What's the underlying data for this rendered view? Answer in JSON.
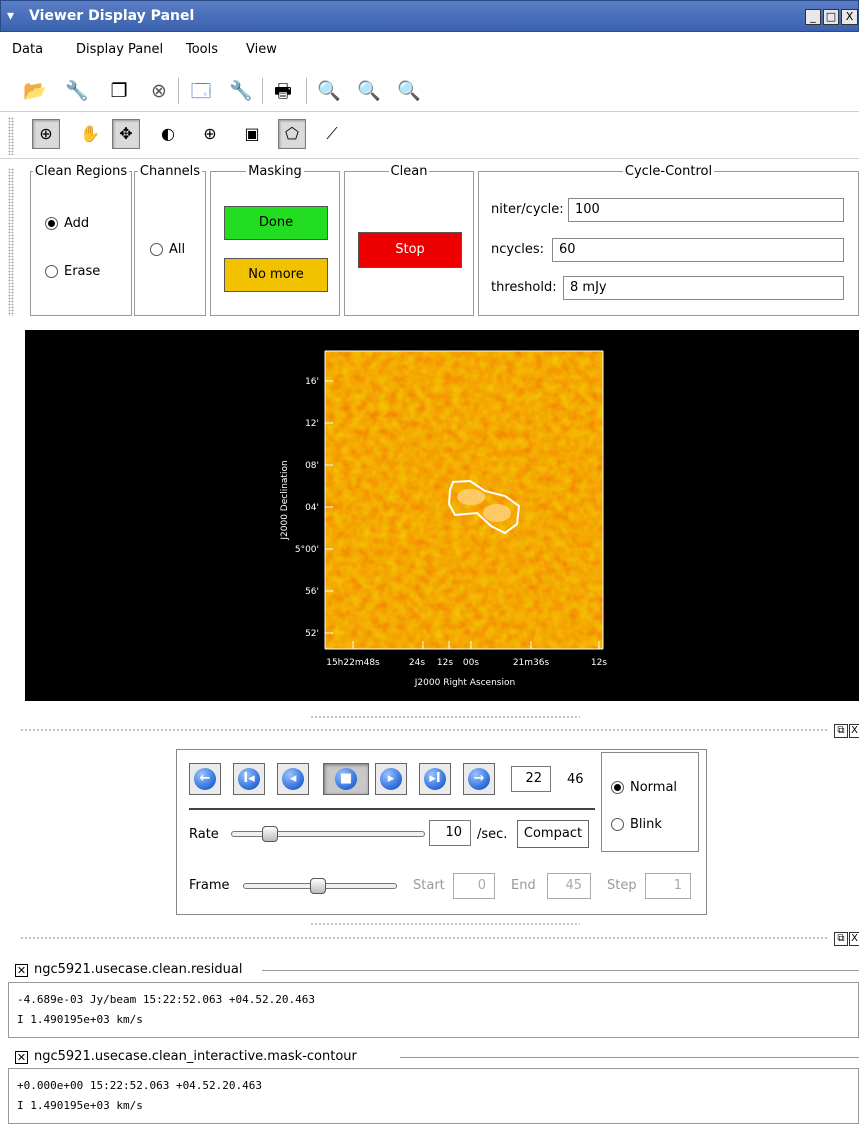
{
  "window": {
    "title": "Viewer Display Panel",
    "minimize": "_",
    "maximize": "□",
    "close": "X"
  },
  "menu": [
    "Data",
    "Display Panel",
    "Tools",
    "View"
  ],
  "toolbar1_icons": [
    "open-icon",
    "wrench-icon",
    "copy-window-icon",
    "close-circle-icon",
    "new-panel-icon",
    "options-icon",
    "print-icon",
    "zoom-fit-icon",
    "zoom-in-icon",
    "zoom-out-icon"
  ],
  "toolbar2_icons": [
    "zoom-tool-icon",
    "pan-tool-icon",
    "move-tool-icon",
    "contrast-tool-icon",
    "crosshair-tool-icon",
    "rectangle-region-icon",
    "polygon-region-icon",
    "polyline-tool-icon"
  ],
  "panels": {
    "clean_regions": {
      "legend": "Clean Regions",
      "add": "Add",
      "erase": "Erase",
      "selected": "Add"
    },
    "channels": {
      "legend": "Channels",
      "all": "All"
    },
    "masking": {
      "legend": "Masking",
      "done": "Done",
      "no_more": "No more"
    },
    "clean": {
      "legend": "Clean",
      "stop": "Stop"
    },
    "cycle_control": {
      "legend": "Cycle-Control",
      "niter_label": "niter/cycle:",
      "niter_value": "100",
      "ncycles_label": "ncycles:",
      "ncycles_value": "60",
      "threshold_label": "threshold:",
      "threshold_value": "8 mJy"
    }
  },
  "colors": {
    "done": "#22dd22",
    "no_more": "#f2c200",
    "stop": "#ee0000",
    "contour": "#ffffff"
  },
  "plot": {
    "yticks": [
      "16'",
      "12'",
      "08'",
      "04'",
      "5°00'",
      "56'",
      "52'"
    ],
    "xticks": [
      "15h22m48s",
      "24s",
      "12s",
      "00s",
      "21m36s",
      "12s"
    ],
    "ylabel": "J2000 Declination",
    "xlabel": "J2000 Right Ascension"
  },
  "animator": {
    "current_frame": "22",
    "total_frames": "46",
    "mode_normal": "Normal",
    "mode_blink": "Blink",
    "mode_selected": "Normal",
    "rate_label": "Rate",
    "rate_value": "10",
    "rate_unit": "/sec.",
    "compact": "Compact",
    "frame_label": "Frame",
    "start_label": "Start",
    "start_value": "0",
    "end_label": "End",
    "end_value": "45",
    "step_label": "Step",
    "step_value": "1",
    "rate_level": 0.2,
    "frame_level": 0.49
  },
  "info": [
    {
      "title": "ngc5921.usecase.clean.residual",
      "line1": "-4.689e-03 Jy/beam    15:22:52.063 +04.52.20.463",
      "line2": "I 1.490195e+03 km/s"
    },
    {
      "title": "ngc5921.usecase.clean_interactive.mask-contour",
      "line1": "+0.000e+00     15:22:52.063 +04.52.20.463",
      "line2": "I 1.490195e+03 km/s"
    }
  ]
}
